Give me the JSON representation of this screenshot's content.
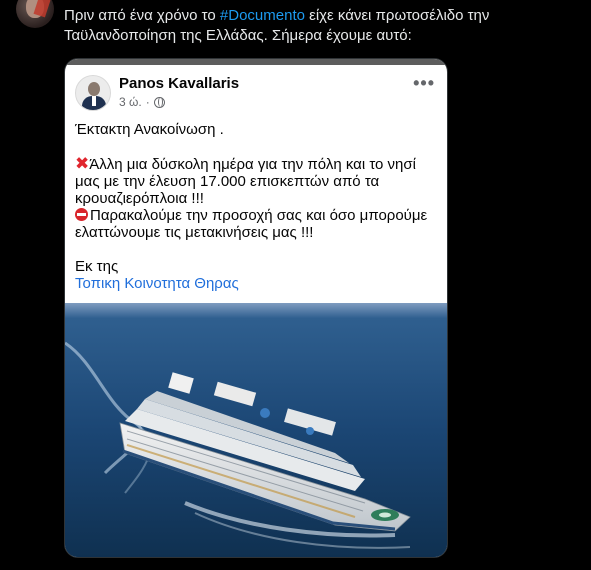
{
  "tweet": {
    "text_before": "Πριν από ένα χρόνο το ",
    "hashtag": "#Documento",
    "text_after": " είχε κάνει πρωτοσέλιδο την Ταϋλανδοποίηση της Ελλάδας. Σήμερα έχουμε αυτό:"
  },
  "facebook_post": {
    "author": "Panos Kavallaris",
    "time": "3 ώ.",
    "more_glyph": "•••",
    "heading": "Έκτακτη Ανακοίνωση .",
    "paragraph1": "Άλλη μια δύσκολη ημέρα για την πόλη και το νησί μας με την έλευση 17.000 επισκεπτών από τα κρουαζιερόπλοια !!!",
    "paragraph2": "Παρακαλούμε την προσοχή σας και όσο μπορούμε ελαττώνουμε τις μετακινήσεις μας !!!",
    "signoff": "Εκ της",
    "signature_link": "Τοπικη Κοινοτητα Θηρας",
    "cross_glyph": "✖",
    "icons": [
      "cross-mark-icon",
      "no-entry-icon",
      "globe-icon",
      "more-options-icon"
    ]
  },
  "colors": {
    "background": "#000000",
    "tweet_text": "#e7e9ea",
    "hashtag": "#1d9bf0",
    "fb_link": "#216fdb"
  }
}
